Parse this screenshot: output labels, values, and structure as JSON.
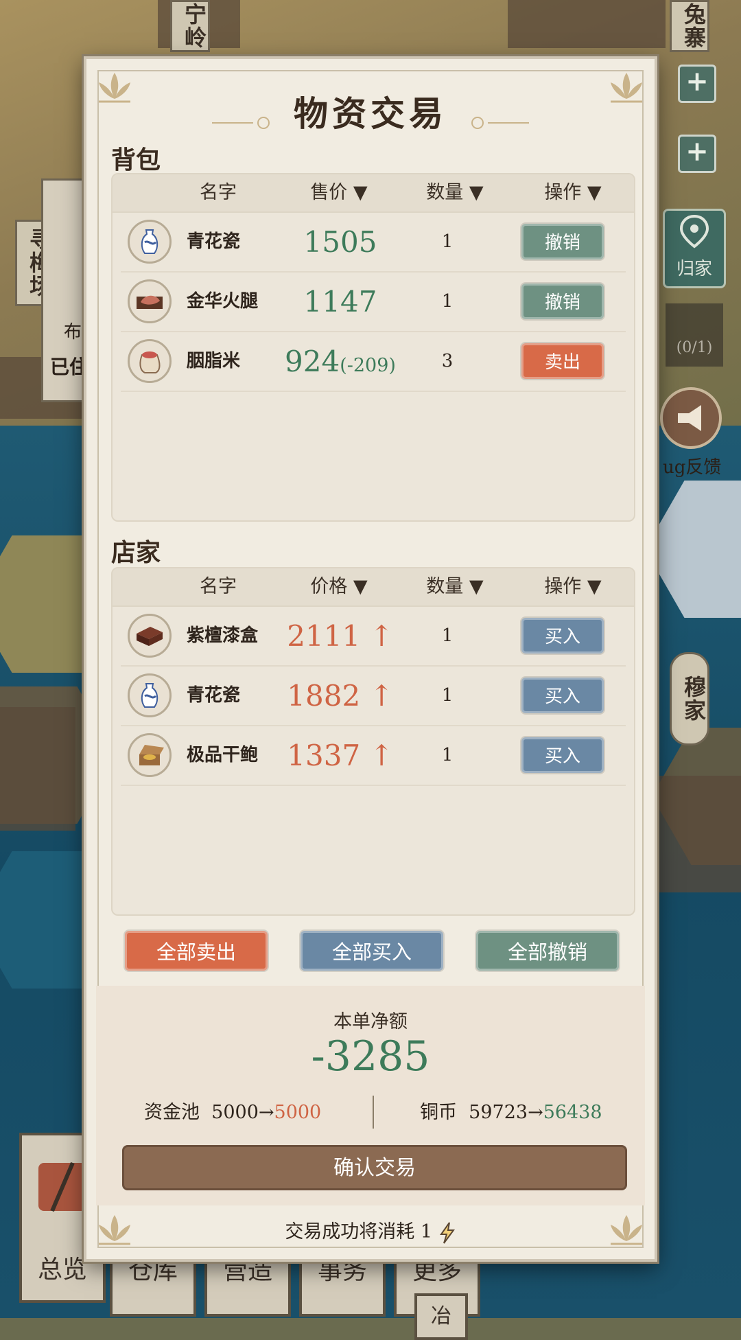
{
  "map_labels": {
    "top_left": "宁岭",
    "top_right": "兔寨",
    "left_mid": "寻梅场",
    "right_mid": "穆家",
    "home_button": "归家",
    "counter": "(0/1)",
    "feedback": "ug反馈",
    "partial_left_1": "布",
    "partial_left_2": "已住",
    "bottom_tab_overview": "总览",
    "bottom_tab_2": "仓库",
    "bottom_tab_3": "营造",
    "bottom_tab_4": "事务",
    "bottom_tab_5": "更多",
    "bottom_partial": "冶"
  },
  "dialog": {
    "title": "物资交易",
    "backpack": {
      "section_title": "背包",
      "headers": {
        "name": "名字",
        "price": "售价 ▼",
        "qty": "数量 ▼",
        "action": "操作 ▼"
      },
      "rows": [
        {
          "icon": "porcelain-vase-icon",
          "name": "青花瓷",
          "price": "1505",
          "delta": "",
          "qty": "1",
          "action": "撤销"
        },
        {
          "icon": "ham-icon",
          "name": "金华火腿",
          "price": "1147",
          "delta": "",
          "qty": "1",
          "action": "撤销"
        },
        {
          "icon": "rice-bag-icon",
          "name": "胭脂米",
          "price": "924",
          "delta": "(-209)",
          "qty": "3",
          "action": "卖出"
        }
      ]
    },
    "shop": {
      "section_title": "店家",
      "headers": {
        "name": "名字",
        "price": "价格 ▼",
        "qty": "数量 ▼",
        "action": "操作 ▼"
      },
      "rows": [
        {
          "icon": "lacquer-box-icon",
          "name": "紫檀漆盒",
          "price": "2111 ↑",
          "qty": "1",
          "action": "买入"
        },
        {
          "icon": "porcelain-vase-icon",
          "name": "青花瓷",
          "price": "1882 ↑",
          "qty": "1",
          "action": "买入"
        },
        {
          "icon": "abalone-box-icon",
          "name": "极品干鲍",
          "price": "1337 ↑",
          "qty": "1",
          "action": "买入"
        }
      ]
    },
    "buttons": {
      "sell_all": "全部卖出",
      "buy_all": "全部买入",
      "cancel_all": "全部撤销"
    },
    "summary": {
      "net_label": "本单净额",
      "net_value": "-3285",
      "fund_label": "资金池",
      "fund_from": "5000→",
      "fund_to": "5000",
      "coin_label": "铜币",
      "coin_from": "59723→",
      "coin_to": "56438",
      "confirm": "确认交易"
    },
    "footer": {
      "text": "交易成功将消耗 1"
    }
  },
  "colors": {
    "green": "#3d7b5a",
    "red": "#cf6444",
    "orange_button": "#d86a48",
    "blue_button": "#6a88a4",
    "gray_button": "#6e9182",
    "confirm_button": "#8b6a52"
  }
}
